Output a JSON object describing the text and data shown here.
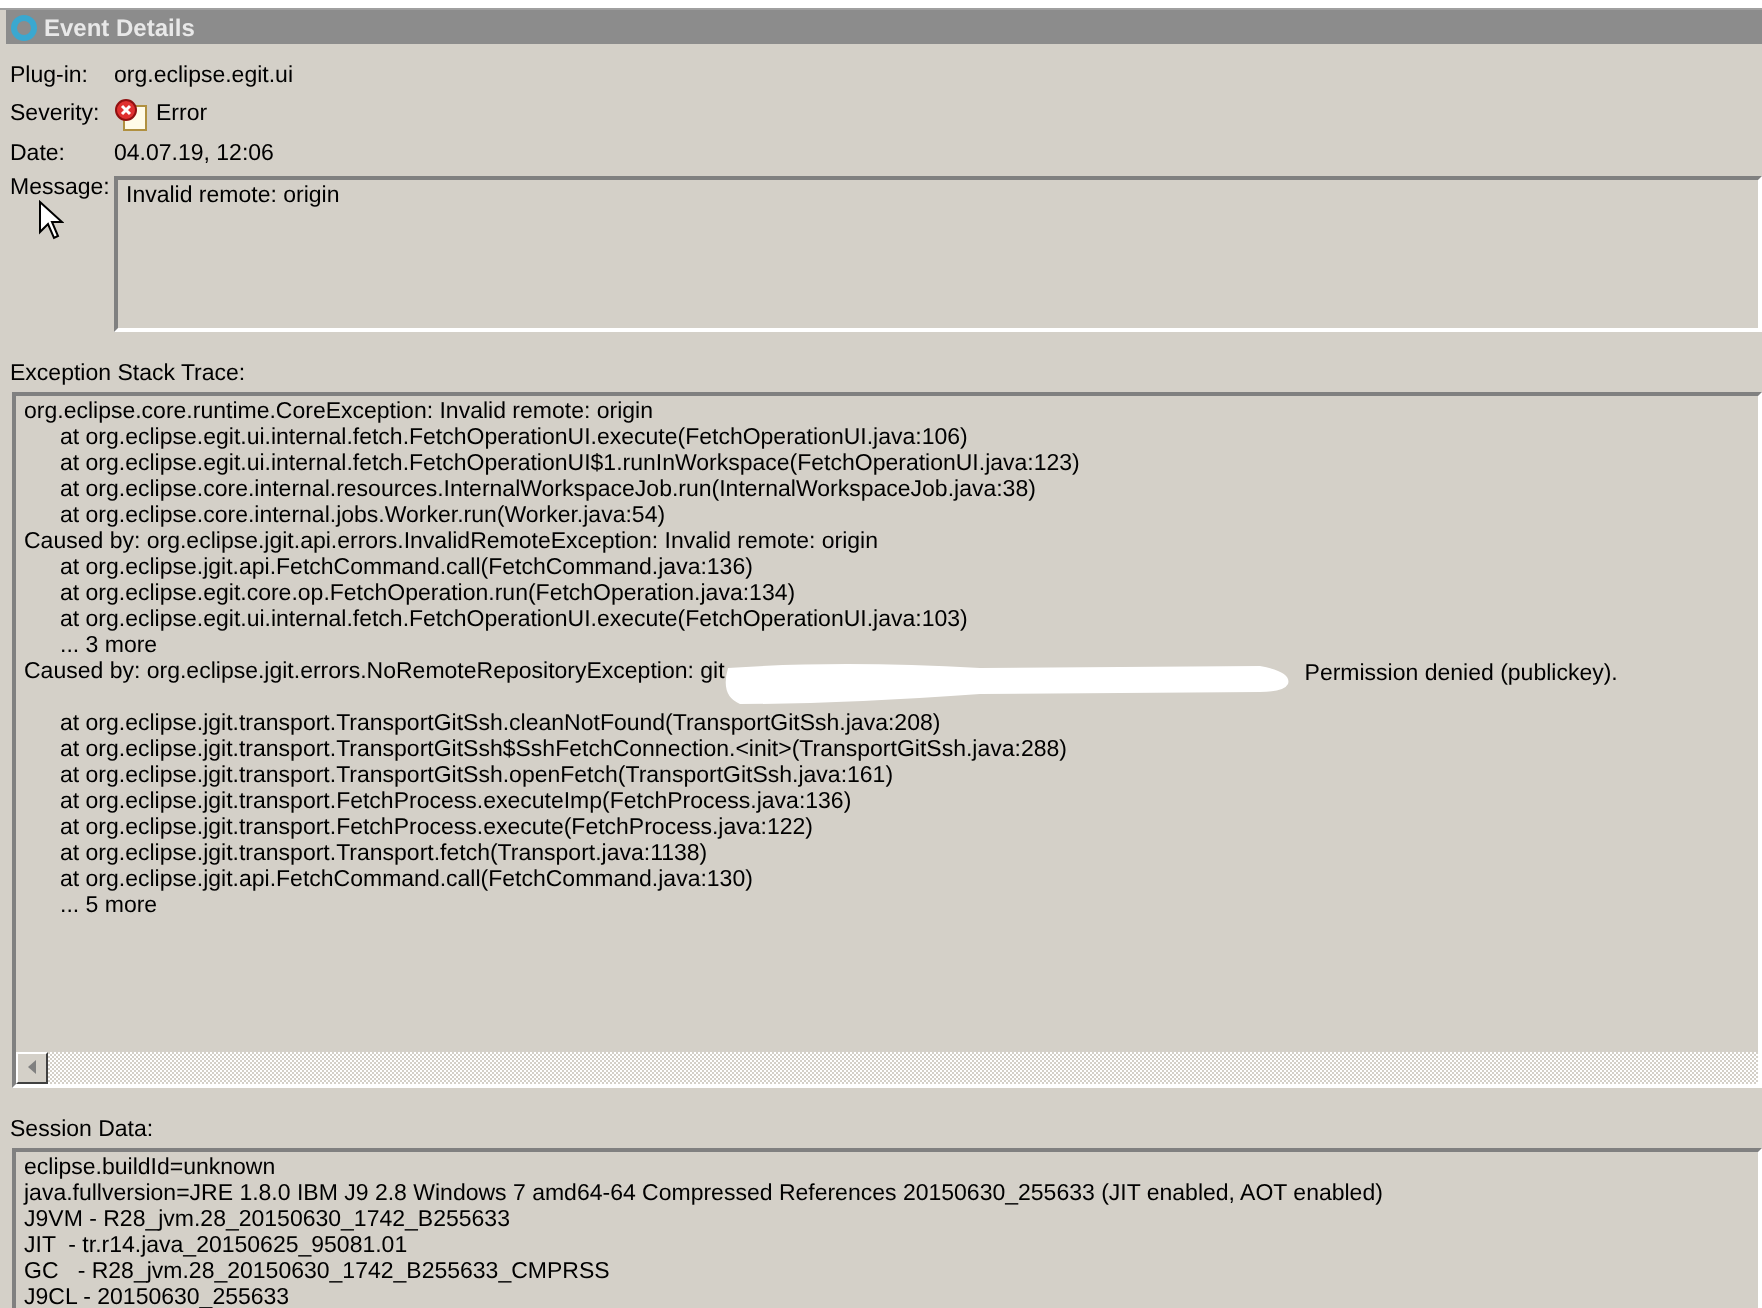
{
  "window": {
    "title": "Event Details"
  },
  "fields": [
    {
      "label": "Plug-in:",
      "value": "org.eclipse.egit.ui",
      "kind": "text"
    },
    {
      "label": "Severity:",
      "value": "Error",
      "kind": "severity"
    },
    {
      "label": "Date:",
      "value": "04.07.19, 12:06",
      "kind": "text"
    }
  ],
  "message": {
    "label": "Message:",
    "value": "Invalid remote: origin"
  },
  "stack_trace": {
    "label": "Exception Stack Trace:",
    "lines": [
      {
        "kind": "head",
        "text": "org.eclipse.core.runtime.CoreException: Invalid remote: origin"
      },
      {
        "kind": "frame",
        "text": "at org.eclipse.egit.ui.internal.fetch.FetchOperationUI.execute(FetchOperationUI.java:106)"
      },
      {
        "kind": "frame",
        "text": "at org.eclipse.egit.ui.internal.fetch.FetchOperationUI$1.runInWorkspace(FetchOperationUI.java:123)"
      },
      {
        "kind": "frame",
        "text": "at org.eclipse.core.internal.resources.InternalWorkspaceJob.run(InternalWorkspaceJob.java:38)"
      },
      {
        "kind": "frame",
        "text": "at org.eclipse.core.internal.jobs.Worker.run(Worker.java:54)"
      },
      {
        "kind": "head",
        "text": "Caused by: org.eclipse.jgit.api.errors.InvalidRemoteException: Invalid remote: origin"
      },
      {
        "kind": "frame",
        "text": "at org.eclipse.jgit.api.FetchCommand.call(FetchCommand.java:136)"
      },
      {
        "kind": "frame",
        "text": "at org.eclipse.egit.core.op.FetchOperation.run(FetchOperation.java:134)"
      },
      {
        "kind": "frame",
        "text": "at org.eclipse.egit.ui.internal.fetch.FetchOperationUI.execute(FetchOperationUI.java:103)"
      },
      {
        "kind": "frame",
        "text": "... 3 more"
      },
      {
        "kind": "redacted",
        "text": "Caused by: org.eclipse.jgit.errors.NoRemoteRepositoryException: git",
        "after": "Permission denied (publickey)."
      },
      {
        "kind": "frame",
        "text": "at org.eclipse.jgit.transport.TransportGitSsh.cleanNotFound(TransportGitSsh.java:208)"
      },
      {
        "kind": "frame",
        "text": "at org.eclipse.jgit.transport.TransportGitSsh$SshFetchConnection.<init>(TransportGitSsh.java:288)"
      },
      {
        "kind": "frame",
        "text": "at org.eclipse.jgit.transport.TransportGitSsh.openFetch(TransportGitSsh.java:161)"
      },
      {
        "kind": "frame",
        "text": "at org.eclipse.jgit.transport.FetchProcess.executeImp(FetchProcess.java:136)"
      },
      {
        "kind": "frame",
        "text": "at org.eclipse.jgit.transport.FetchProcess.execute(FetchProcess.java:122)"
      },
      {
        "kind": "frame",
        "text": "at org.eclipse.jgit.transport.Transport.fetch(Transport.java:1138)"
      },
      {
        "kind": "frame",
        "text": "at org.eclipse.jgit.api.FetchCommand.call(FetchCommand.java:130)"
      },
      {
        "kind": "frame",
        "text": "... 5 more"
      }
    ]
  },
  "session_data": {
    "label": "Session Data:",
    "lines": [
      "eclipse.buildId=unknown",
      "java.fullversion=JRE 1.8.0 IBM J9 2.8 Windows 7 amd64-64 Compressed References 20150630_255633 (JIT enabled, AOT enabled)",
      "J9VM - R28_jvm.28_20150630_1742_B255633",
      "JIT  - tr.r14.java_20150625_95081.01",
      "GC   - R28_jvm.28_20150630_1742_B255633_CMPRSS",
      "J9CL - 20150630_255633"
    ]
  }
}
